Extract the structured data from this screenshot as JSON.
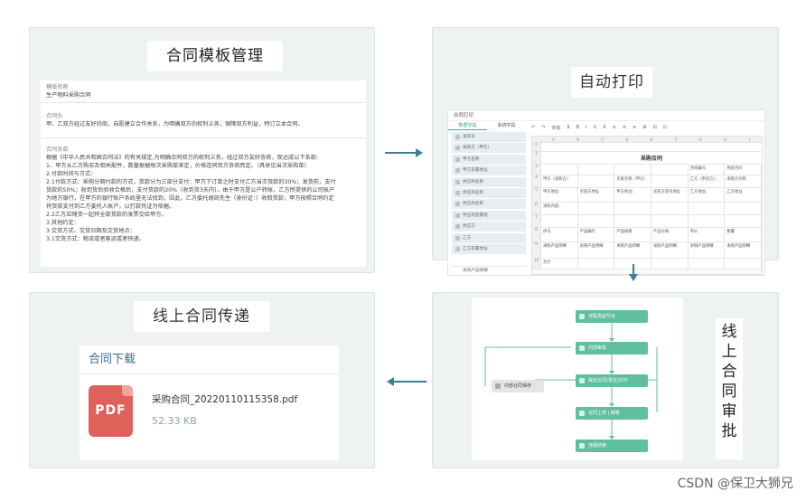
{
  "panels": {
    "template": {
      "title": "合同模板管理",
      "sections": [
        {
          "label": "模版名称",
          "lines": [
            "生产物料采购合同"
          ]
        },
        {
          "label": "合同头",
          "lines": [
            "甲、乙双方经过友好协商，自愿建立合作关系，为明确双方的权利义务，保障双方利益，特订立本合同。"
          ]
        },
        {
          "label": "合同条款",
          "lines": [
            "根据《中华人民共和国合同法》的有关规定,为明确合同双方的权利义务，经过双方友好协商，现达成以下条款:",
            "1、甲方从乙方购买及相关配件，数量根据每次采购单来定，价格连同双方协商而定。（具体见当次采购单）",
            "2.付款时间与方式：",
            "2.1付款方式：采购分期付款的方式，货款分为三部分支付：甲方下订单之时支付乙方当次货款的30%；发货前，支付",
            "货款的50%；收到货后验收合格后，支付货款的20%（收到货3天内）。由于甲方是公户转账，乙方所提供的公司账户",
            "为地方银行，在甲方的银行账户系统里无法找到，因此，乙方委托胡凯先生（身份证：）收取货款，甲方按照合同约定",
            "将货款支付到乙方委托人账户，以打款凭证为依据。",
            "2.2乙方应随货一起将全部货款的发票交给甲方。",
            "3.其他约定：",
            "3.交货方式、交货日期及交货地点：",
            "3.1交货方式：物流或者客运或者快递。"
          ]
        }
      ]
    },
    "print": {
      "title": "自动打印",
      "app_label": "合同打印",
      "tabs": [
        "数据字段",
        "系统字段"
      ],
      "side_items": [
        "请求号",
        "采购方（甲方）",
        "甲方名称",
        "甲方签署地址",
        "供应商名称",
        "供应商名称",
        "供应商名称",
        "供应商签署地",
        "供应方",
        "乙方",
        "乙方签署地址"
      ],
      "side_footer": "采购产品明细",
      "toolbar": [
        "↶",
        "↷",
        "宋体",
        "9",
        "B",
        "I",
        "U",
        "A",
        "≡",
        "≡",
        "≡",
        "⊞",
        "⊟",
        "⊡"
      ],
      "col_heads": [
        "",
        "A",
        "B",
        "C",
        "D",
        "E",
        "F",
        "G",
        "H",
        "I"
      ],
      "rows": [
        {
          "n": "1",
          "type": "blank"
        },
        {
          "n": "2",
          "type": "title",
          "text": "采购合同"
        },
        {
          "n": "3",
          "type": "cells",
          "cells": [
            "",
            "",
            "",
            "",
            "合同编号：",
            "预览合同"
          ]
        },
        {
          "n": "4",
          "type": "cells",
          "cells": [
            "甲方（采购方）：",
            "",
            "买家名称（甲方）",
            "",
            "乙方（供货方）：",
            "采购方名称"
          ]
        },
        {
          "n": "5",
          "type": "cells",
          "cells": [
            "甲方地址：",
            "买家方地址",
            "甲方地址：",
            "买家方签名地址",
            "乙方地址：",
            "乙方地址"
          ]
        },
        {
          "n": "6",
          "type": "cells",
          "cells": [
            "采购内容：",
            "",
            "",
            "",
            "",
            ""
          ]
        },
        {
          "n": "7",
          "type": "cells",
          "cells": [
            "",
            "",
            "",
            "",
            "",
            ""
          ]
        },
        {
          "n": "8",
          "type": "cells",
          "cells": [
            "序号",
            "产品编号",
            "产品规格",
            "产品价格",
            "单价",
            "数量"
          ]
        },
        {
          "n": "9",
          "type": "cells",
          "cells": [
            "采购产品明细",
            "采购产品明细",
            "采购产品明细",
            "采购产品明细",
            "采购产品明细",
            "采购产品明细"
          ]
        },
        {
          "n": "10",
          "type": "cells",
          "cells": [
            "合计",
            "",
            "",
            "",
            "",
            ""
          ]
        }
      ]
    },
    "delivery": {
      "title": "线上合同传递",
      "card_title": "合同下载",
      "file_icon": "PDF",
      "file_name": "采购合同_20220110115358.pdf",
      "file_size": "52.33 KB"
    },
    "approval": {
      "title_chars": [
        "线",
        "上",
        "合",
        "同",
        "审",
        "批"
      ],
      "nodes": [
        "流程发起节点",
        "内部审批",
        "保证合同(单位)打印",
        "合同上传 | 邮寄",
        "流程结束"
      ],
      "side_node": "内部合同保存"
    }
  },
  "watermark": "CSDN @保卫大狮兄",
  "colors": {
    "accent": "#3f7d96",
    "node": "#5fbf9f",
    "pdf": "#e0615a"
  }
}
